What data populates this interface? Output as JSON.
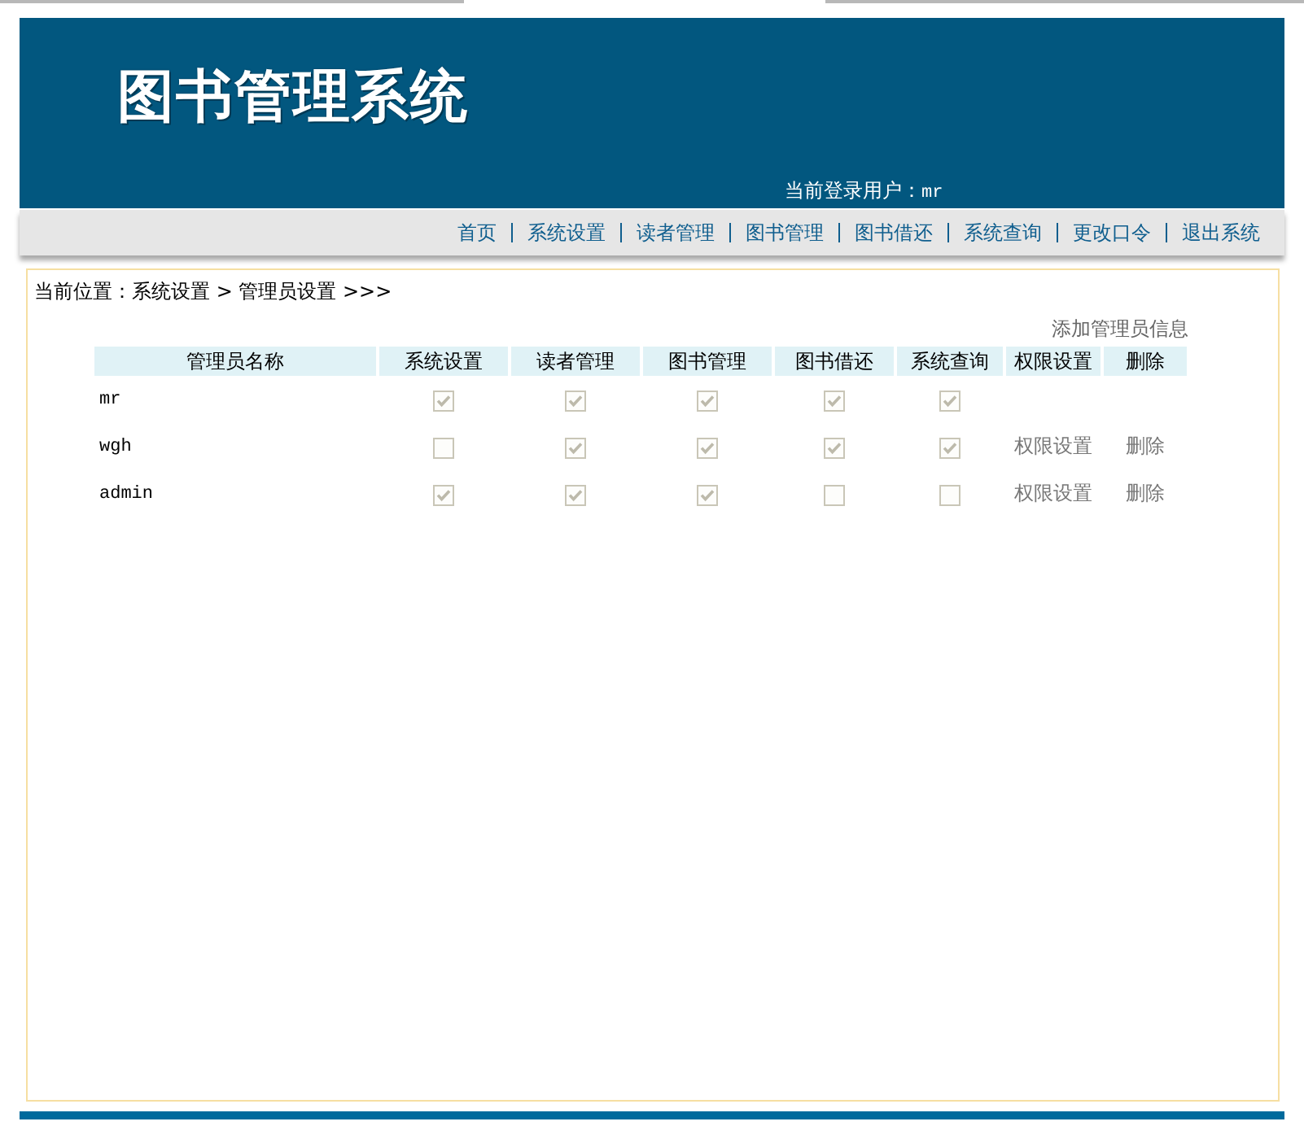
{
  "header": {
    "logo": "图书管理系统",
    "user_label": "当前登录用户：",
    "user_name": "mr"
  },
  "nav": [
    "首页",
    "系统设置",
    "读者管理",
    "图书管理",
    "图书借还",
    "系统查询",
    "更改口令",
    "退出系统"
  ],
  "breadcrumb": "当前位置：系统设置 > 管理员设置 >>>",
  "add_link": "添加管理员信息",
  "table": {
    "columns": [
      "管理员名称",
      "系统设置",
      "读者管理",
      "图书管理",
      "图书借还",
      "系统查询",
      "权限设置",
      "删除"
    ],
    "checkboxes_disabled": true,
    "rows": [
      {
        "name": "mr",
        "checks": [
          true,
          true,
          true,
          true,
          true
        ]
      },
      {
        "name": "wgh",
        "checks": [
          false,
          true,
          true,
          true,
          true
        ],
        "actions": [
          "权限设置",
          "删除"
        ]
      },
      {
        "name": "admin",
        "checks": [
          true,
          true,
          true,
          false,
          false
        ],
        "actions": [
          "权限设置",
          "删除"
        ]
      }
    ]
  }
}
